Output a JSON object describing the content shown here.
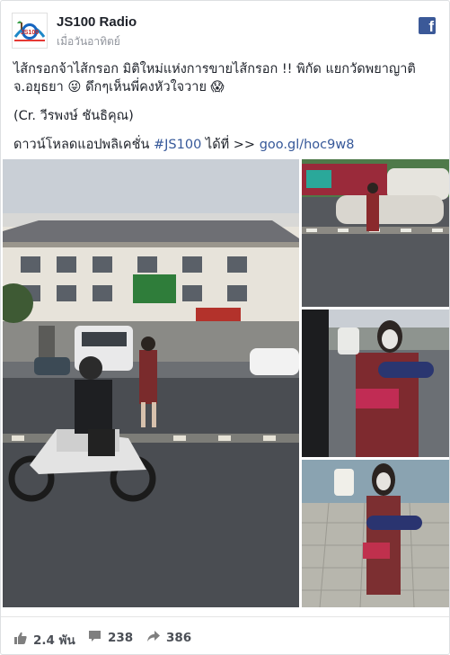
{
  "post": {
    "page_name": "JS100 Radio",
    "timestamp": "เมื่อวันอาทิตย์",
    "logo_text": "JS100",
    "platform_icon": "facebook-icon",
    "text_line1": "ไส้กรอกจ้าไส้กรอก มิติใหม่แห่งการขายไส้กรอก !! พิกัด แยกวัดพยาญาติ จ.อยุธยา 😜 ดึกๆเห็นพี่คงหัวใจวาย 😱",
    "credit": "(Cr. วีรพงษ์ ชันธิคุณ)",
    "download_prefix": "ดาวน์โหลดแอปพลิเคชั่น",
    "hashtag": "#JS100",
    "download_mid": "ได้ที่ >>",
    "link": "goo.gl/hoc9w8"
  },
  "stats": {
    "likes": "2.4 พัน",
    "comments": "238",
    "shares": "386"
  },
  "colors": {
    "link": "#365899",
    "facebook_blue": "#3b5998",
    "muted": "#90949c"
  }
}
